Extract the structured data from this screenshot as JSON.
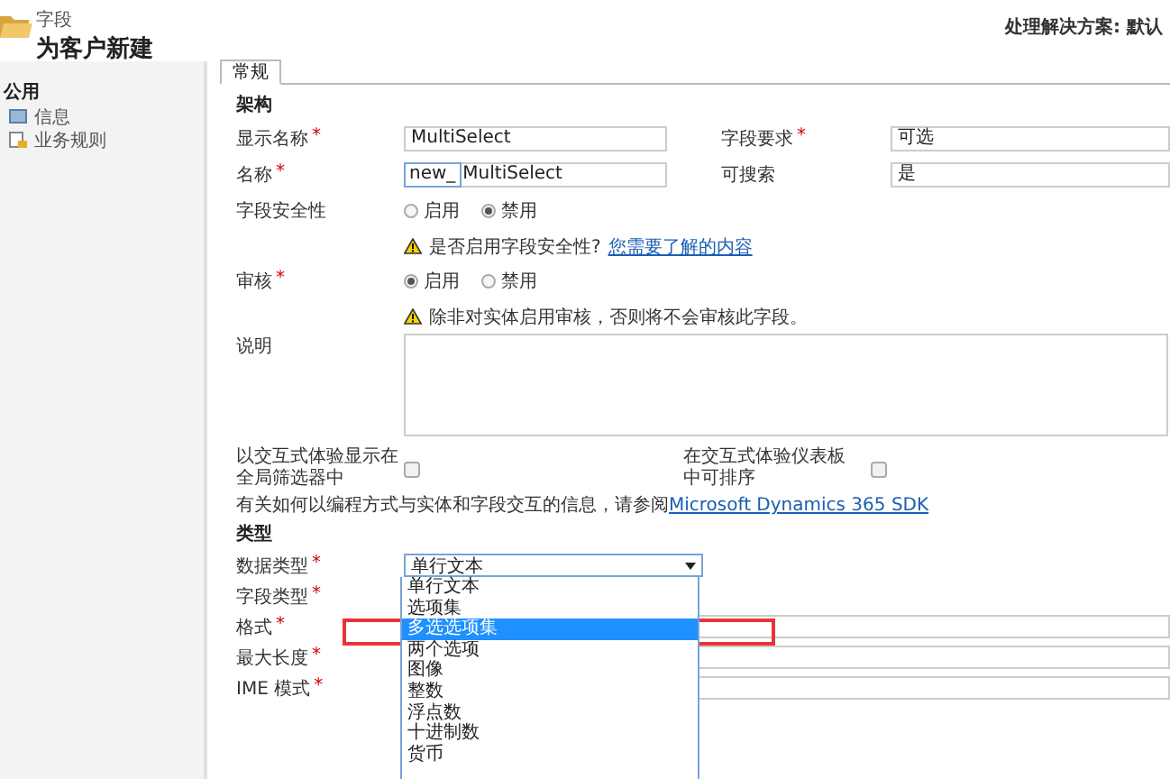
{
  "header": {
    "entity_label": "字段",
    "title": "为客户新建",
    "solution": "处理解决方案: 默认"
  },
  "sidebar": {
    "section": "公用",
    "items": [
      {
        "label": "信息",
        "kind": "form"
      },
      {
        "label": "业务规则",
        "kind": "rule"
      }
    ]
  },
  "tabs": [
    {
      "label": "常规",
      "selected": true
    }
  ],
  "schema": {
    "heading": "架构",
    "pairs": [
      {
        "label": "显示名称",
        "required": true,
        "value": "MultiSelect",
        "label2": "字段要求",
        "required2": true,
        "value2": "可选"
      },
      {
        "label": "名称",
        "required": true,
        "prefix": "new_",
        "value": "MultiSelect",
        "label2": "可搜索",
        "required2": false,
        "value2": "是"
      }
    ],
    "security": {
      "label": "字段安全性",
      "options": [
        {
          "label": "启用",
          "selected": false
        },
        {
          "label": "禁用",
          "selected": true
        }
      ],
      "warning": "是否启用字段安全性?",
      "link": "您需要了解的内容"
    },
    "audit": {
      "label": "审核",
      "required": true,
      "options": [
        {
          "label": "启用",
          "selected": true
        },
        {
          "label": "禁用",
          "selected": false
        }
      ],
      "warning": "除非对实体启用审核，否则将不会审核此字段。"
    },
    "description": {
      "label": "说明"
    },
    "checkboxes": [
      {
        "label": "以交互式体验显示在全局筛选器中",
        "checked": false
      },
      {
        "label": "在交互式体验仪表板中可排序",
        "checked": false
      }
    ],
    "info": "有关如何以编程方式与实体和字段交互的信息，请参阅",
    "info_link": "Microsoft Dynamics 365 SDK"
  },
  "type": {
    "heading": "类型",
    "required_marker": "*",
    "rows": [
      {
        "label": "数据类型",
        "required": true,
        "kind": "select",
        "value": "单行文本"
      },
      {
        "label": "字段类型",
        "required": true,
        "kind": "hidden"
      },
      {
        "label": "格式",
        "required": true,
        "kind": "field"
      },
      {
        "label": "最大长度",
        "required": true,
        "kind": "field"
      },
      {
        "label": "IME 模式",
        "required": true,
        "kind": "field"
      }
    ],
    "options": [
      {
        "label": "单行文本",
        "selected": false
      },
      {
        "label": "选项集",
        "selected": false
      },
      {
        "label": "多选选项集",
        "selected": true
      },
      {
        "label": "两个选项",
        "selected": false
      },
      {
        "label": "图像",
        "selected": false
      },
      {
        "label": "整数",
        "selected": false
      },
      {
        "label": "浮点数",
        "selected": false
      },
      {
        "label": "十进制数",
        "selected": false
      },
      {
        "label": "货币",
        "selected": false
      }
    ]
  }
}
